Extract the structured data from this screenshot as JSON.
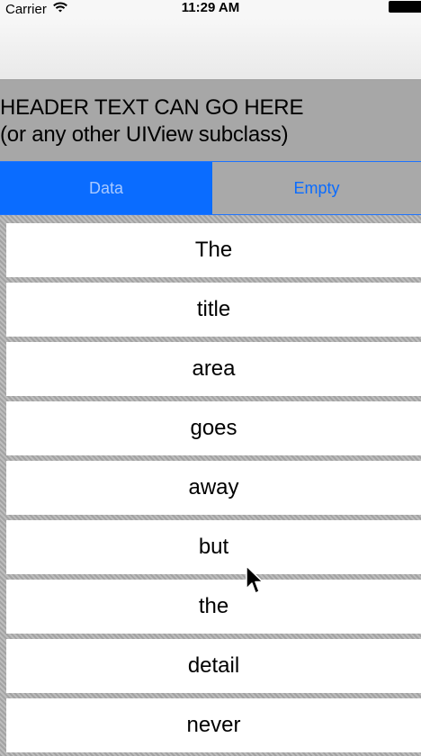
{
  "status_bar": {
    "carrier": "Carrier",
    "time": "11:29 AM"
  },
  "header": {
    "line1": "HEADER TEXT CAN GO HERE",
    "line2": "(or any other UIView subclass)"
  },
  "segmented": {
    "selected": "Data",
    "options": [
      "Data",
      "Empty"
    ]
  },
  "list": {
    "items": [
      "The",
      "title",
      "area",
      "goes",
      "away",
      "but",
      "the",
      "detail",
      "never"
    ]
  },
  "colors": {
    "accent": "#0a6cff",
    "header_bg": "#a7a7a7",
    "row_bg": "#ffffff"
  }
}
